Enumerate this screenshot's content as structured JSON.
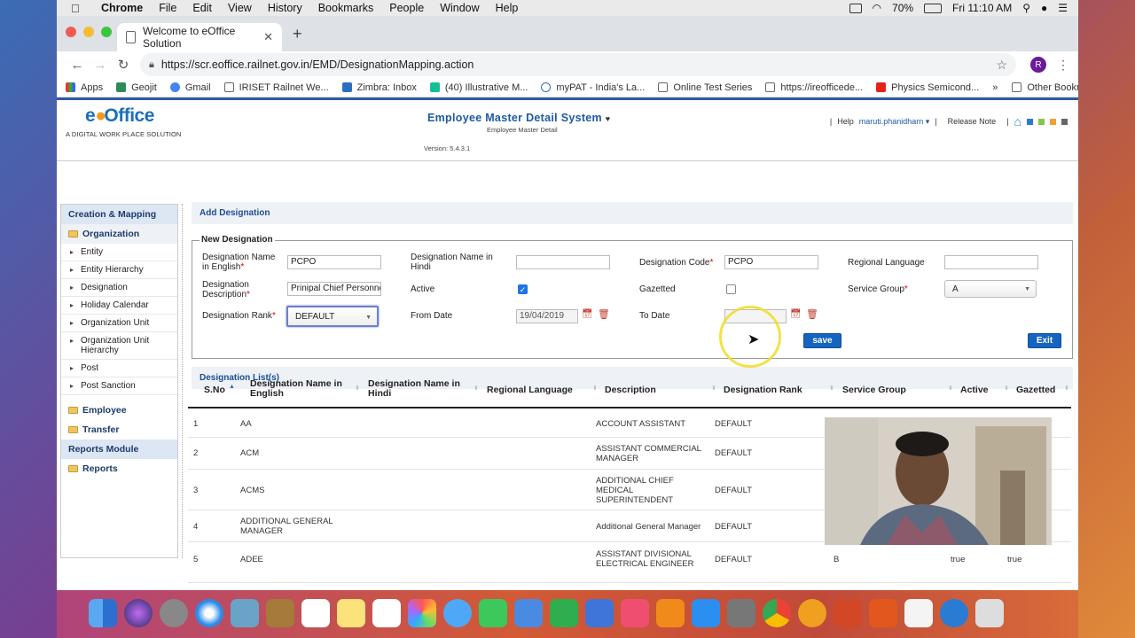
{
  "menubar": {
    "apple": "",
    "app": "Chrome",
    "items": [
      "File",
      "Edit",
      "View",
      "History",
      "Bookmarks",
      "People",
      "Window",
      "Help"
    ],
    "battery": "70%",
    "clock": "Fri 11:10 AM"
  },
  "browser": {
    "tab_title": "Welcome to eOffice Solution",
    "url": "https://scr.eoffice.railnet.gov.in/EMD/DesignationMapping.action",
    "avatar_letter": "R",
    "bookmarks": [
      "Apps",
      "Geojit",
      "Gmail",
      "IRISET Railnet We...",
      "Zimbra: Inbox",
      "(40) Illustrative M...",
      "myPAT - India's La...",
      "Online Test Series",
      "https://ireofficede...",
      "Physics Semicond..."
    ],
    "bookmarks_more": "»",
    "other_bookmarks": "Other Bookmarks"
  },
  "header": {
    "logo_e": "e",
    "logo_office": "Office",
    "logo_tagline": "A DIGITAL WORK PLACE SOLUTION",
    "title": "Employee Master Detail System",
    "subtitle": "Employee Master Detail",
    "version": "Version: 5.4.3.1",
    "help": "Help",
    "user": "maruti.phanidharn",
    "release_note": "Release Note",
    "separators": "|"
  },
  "sidebar": {
    "section1": "Creation & Mapping",
    "folder_org": "Organization",
    "items": [
      "Entity",
      "Entity Hierarchy",
      "Designation",
      "Holiday Calendar",
      "Organization Unit",
      "Organization Unit Hierarchy",
      "Post",
      "Post Sanction"
    ],
    "folder_employee": "Employee",
    "folder_transfer": "Transfer",
    "section2": "Reports Module",
    "folder_reports": "Reports"
  },
  "form": {
    "panel_title": "Add Designation",
    "legend": "New Designation",
    "name_en_label_1": "Designation Name",
    "name_en_label_2": "in English",
    "name_en_value": "PCPO",
    "name_hi_label_1": "Designation Name in",
    "name_hi_label_2": "Hindi",
    "name_hi_value": "",
    "code_label": "Designation Code",
    "code_value": "PCPO",
    "regional_label": "Regional Language",
    "regional_value": "",
    "desc_label_1": "Designation",
    "desc_label_2": "Description",
    "desc_value": "Prinipal Chief Personne",
    "active_label": "Active",
    "active_checked": true,
    "gazetted_label": "Gazetted",
    "gazetted_checked": false,
    "service_group_label": "Service Group",
    "service_group_value": "A",
    "rank_label": "Designation Rank",
    "rank_value": "DEFAULT",
    "from_date_label": "From Date",
    "from_date_value": "19/04/2019",
    "to_date_label": "To Date",
    "to_date_value": "",
    "required_mark": "*",
    "save_label": "save",
    "exit_label": "Exit"
  },
  "list": {
    "panel_title": "Designation List(s)",
    "columns": [
      "S.No",
      "Designation Name in English",
      "Designation Name in Hindi",
      "Regional Language",
      "Description",
      "Designation Rank",
      "Service Group",
      "Active",
      "Gazetted"
    ],
    "rows": [
      {
        "sno": "1",
        "name": "AA",
        "desc": "ACCOUNT ASSISTANT",
        "rank": "DEFAULT",
        "group": "",
        "active": "",
        "gazetted": ""
      },
      {
        "sno": "2",
        "name": "ACM",
        "desc": "ASSISTANT COMMERCIAL MANAGER",
        "rank": "DEFAULT",
        "group": "",
        "active": "",
        "gazetted": ""
      },
      {
        "sno": "3",
        "name": "ACMS",
        "desc": "ADDITIONAL CHIEF MEDICAL SUPERINTENDENT",
        "rank": "DEFAULT",
        "group": "",
        "active": "",
        "gazetted": ""
      },
      {
        "sno": "4",
        "name": "ADDITIONAL GENERAL MANAGER",
        "desc": "Additional General Manager",
        "rank": "DEFAULT",
        "group": "",
        "active": "",
        "gazetted": ""
      },
      {
        "sno": "5",
        "name": "ADEE",
        "desc": "ASSISTANT DIVISIONAL ELECTRICAL ENGINEER",
        "rank": "DEFAULT",
        "group": "B",
        "active": "true",
        "gazetted": "true"
      }
    ]
  },
  "colors": {
    "accent": "#1d5aa2",
    "button": "#1565c0",
    "logo_orange": "#f29a1b"
  }
}
